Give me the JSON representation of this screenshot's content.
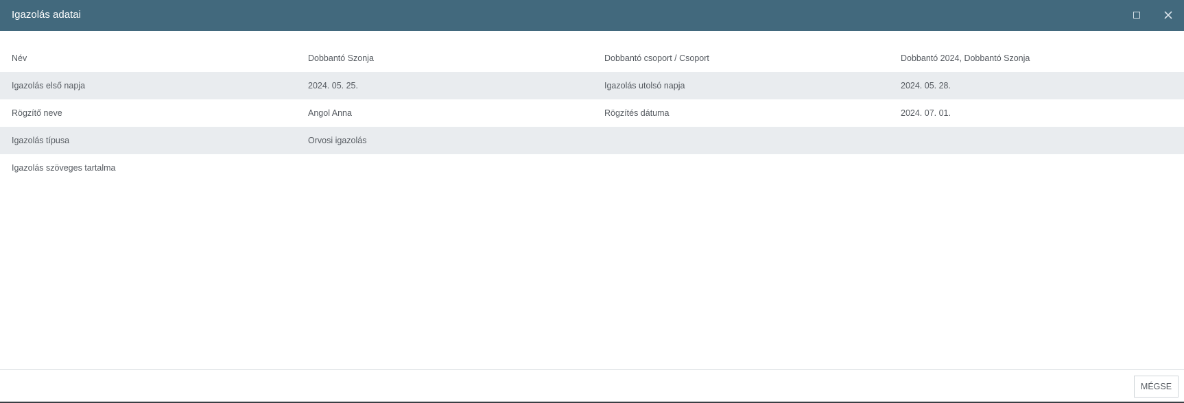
{
  "window": {
    "title": "Igazolás adatai",
    "maximize_icon": "maximize-icon",
    "close_icon": "close-icon",
    "titlebar_color": "#42697d"
  },
  "details": {
    "rows": [
      {
        "label1": "Név",
        "value1": "Dobbantó Szonja",
        "label2": "Dobbantó csoport / Csoport",
        "value2": "Dobbantó 2024, Dobbantó Szonja"
      },
      {
        "label1": "Igazolás első napja",
        "value1": "2024. 05. 25.",
        "label2": "Igazolás utolsó napja",
        "value2": "2024. 05. 28."
      },
      {
        "label1": "Rögzítő neve",
        "value1": "Angol Anna",
        "label2": "Rögzítés dátuma",
        "value2": "2024. 07. 01."
      },
      {
        "label1": "Igazolás típusa",
        "value1": "Orvosi igazolás",
        "label2": "",
        "value2": ""
      },
      {
        "label1": "Igazolás szöveges tartalma",
        "value1": "",
        "label2": "",
        "value2": ""
      }
    ]
  },
  "footer": {
    "cancel_label": "MÉGSE"
  }
}
